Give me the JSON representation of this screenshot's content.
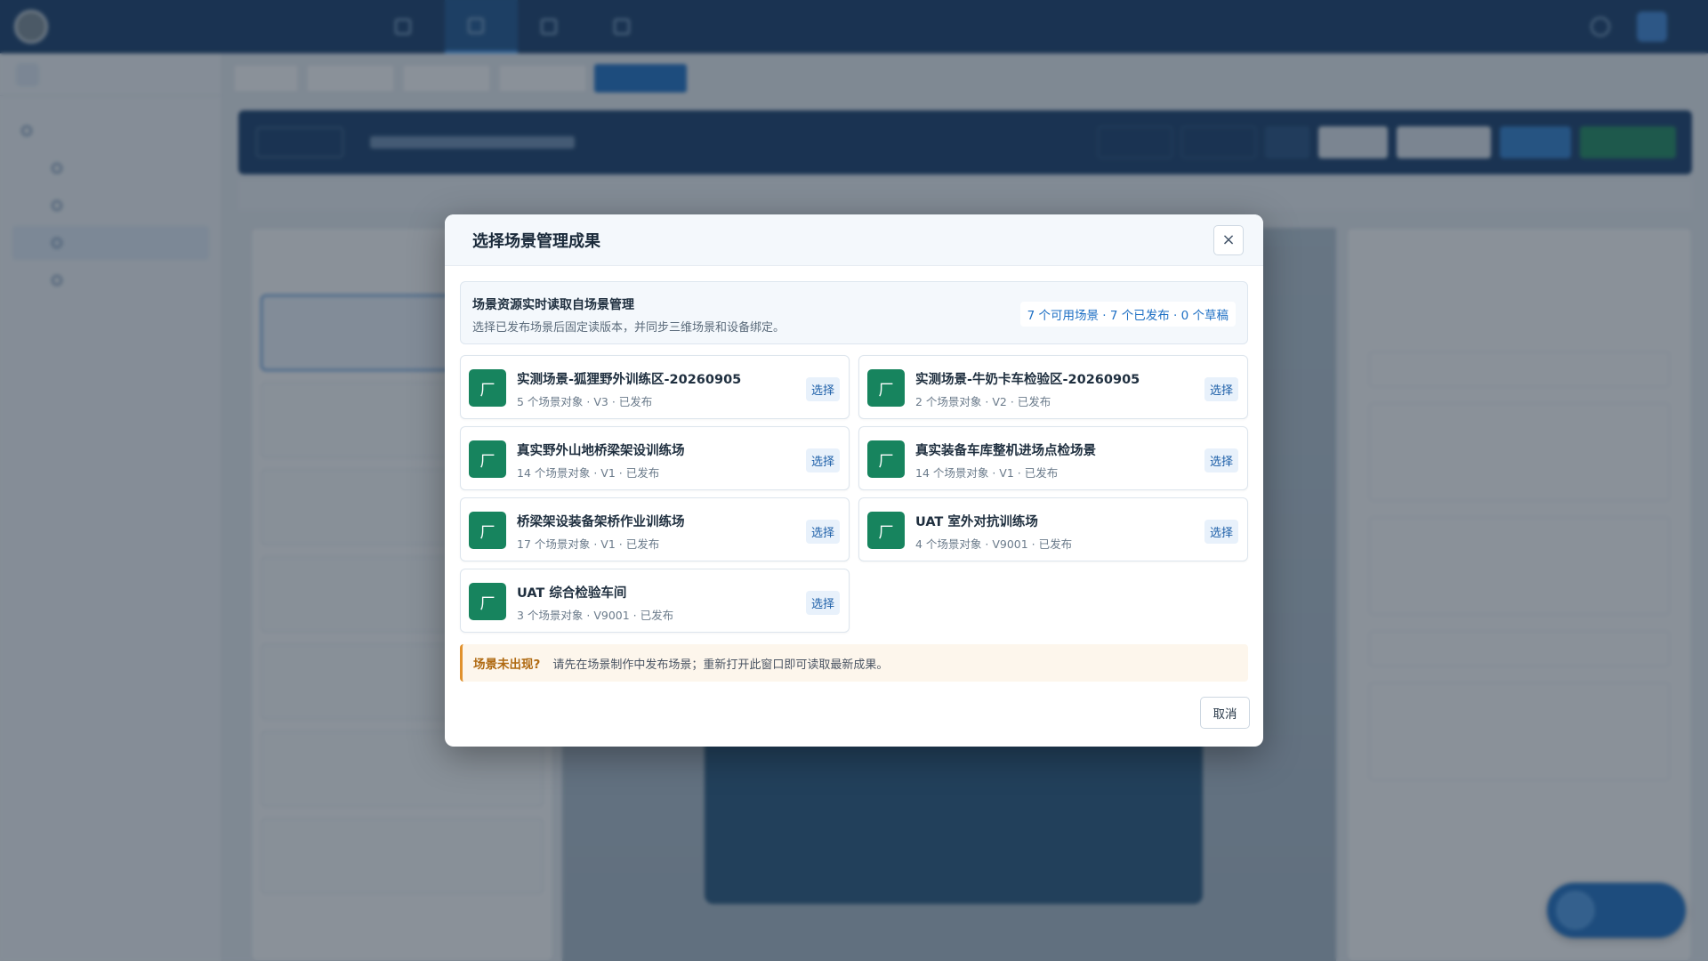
{
  "modal": {
    "title": "选择场景管理成果",
    "close_icon": "×",
    "info": {
      "title": "场景资源实时读取自场景管理",
      "subtitle": "选择已发布场景后固定读版本，并同步三维场景和设备绑定。",
      "summary": "7 个可用场景 · 7 个已发布 · 0 个草稿"
    },
    "scene_icon": "厂",
    "select_label": "选择",
    "scenes": [
      {
        "name": "实测场景-狐狸野外训练区-20260905",
        "meta": "5 个场景对象 · V3 · 已发布"
      },
      {
        "name": "实测场景-牛奶卡车检验区-20260905",
        "meta": "2 个场景对象 · V2 · 已发布"
      },
      {
        "name": "真实野外山地桥梁架设训练场",
        "meta": "14 个场景对象 · V1 · 已发布"
      },
      {
        "name": "真实装备车库整机进场点检场景",
        "meta": "14 个场景对象 · V1 · 已发布"
      },
      {
        "name": "桥梁架设装备架桥作业训练场",
        "meta": "17 个场景对象 · V1 · 已发布"
      },
      {
        "name": "UAT 室外对抗训练场",
        "meta": "4 个场景对象 · V9001 · 已发布"
      },
      {
        "name": "UAT 综合检验车间",
        "meta": "3 个场景对象 · V9001 · 已发布"
      }
    ],
    "warning": {
      "label": "场景未出现?",
      "text": "请先在场景制作中发布场景；重新打开此窗口即可读取最新成果。"
    },
    "cancel_label": "取消"
  },
  "colors": {
    "brand_dark": "#163c6b",
    "accent_blue": "#1d6fc4",
    "scene_green": "#17845e",
    "warning_orange": "#e0912d"
  }
}
